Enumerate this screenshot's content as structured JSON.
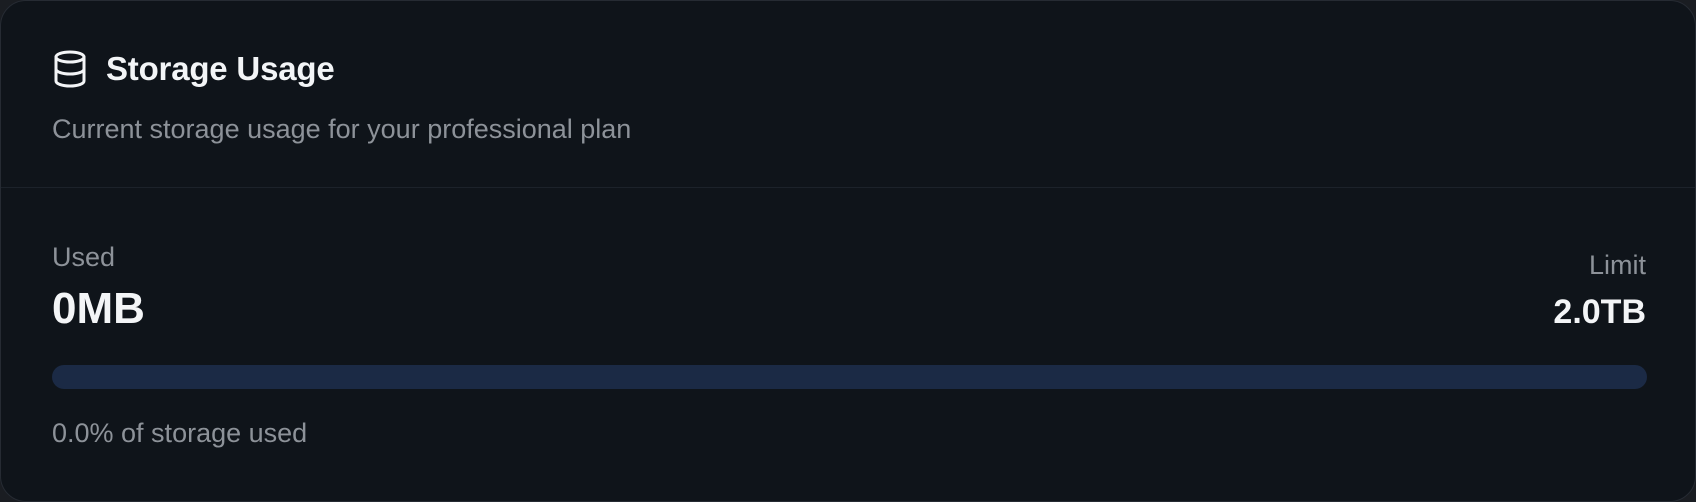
{
  "card": {
    "title": "Storage Usage",
    "subtitle": "Current storage usage for your professional plan",
    "icon": "database-icon"
  },
  "usage": {
    "used_label": "Used",
    "used_value": "0MB",
    "limit_label": "Limit",
    "limit_value": "2.0TB",
    "progress_percent": 0.0,
    "percent_text": "0.0% of storage used"
  },
  "colors": {
    "background": "#0f141a",
    "track": "#1b2a45",
    "fill": "#3b82f6",
    "text_primary": "#f3f5f7",
    "text_muted": "#8d9299"
  }
}
